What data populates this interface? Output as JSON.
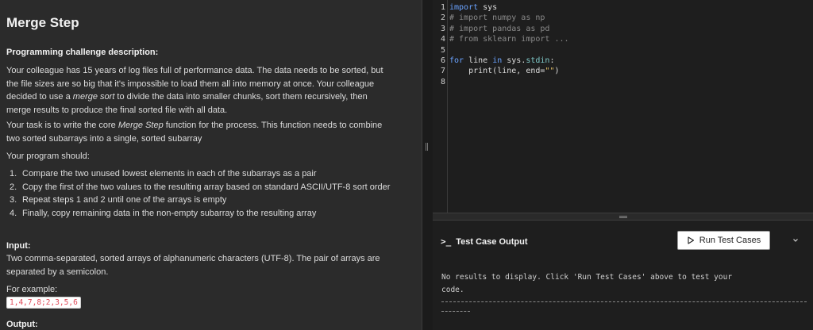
{
  "problem": {
    "title": "Merge Step",
    "section_heading": "Programming challenge description:",
    "para1": [
      "Your colleague has 15 years of log files full of performance data. The data needs to be sorted, but",
      "the file sizes are so big that it's impossible to load them all into memory at once. Your colleague",
      "decided to use a ",
      "merge sort",
      " to divide the data into smaller chunks, sort them recursively, then",
      "merge results to produce the final sorted file with all data."
    ],
    "para2": [
      "Your task is to write the core ",
      "Merge Step",
      " function for the process. This function needs to combine",
      "two sorted subarrays into a single, sorted subarray"
    ],
    "para3": "Your program should:",
    "steps": [
      {
        "num": "1.",
        "text": "Compare the two unused lowest elements in each of the subarrays as a pair"
      },
      {
        "num": "2.",
        "text": "Copy the first of the two values to the resulting array based on standard ASCII/UTF-8 sort order"
      },
      {
        "num": "3.",
        "text": "Repeat steps 1 and 2 until one of the arrays is empty"
      },
      {
        "num": "4.",
        "text": "Finally, copy remaining data in the non-empty subarray to the resulting array"
      }
    ],
    "input_heading": "Input:",
    "input_desc": [
      "Two comma-separated, sorted arrays of alphanumeric characters (UTF-8). The pair of arrays are",
      "separated by a semicolon."
    ],
    "example_label": "For example:",
    "example_value": "1,4,7,8;2,3,5,6",
    "output_heading": "Output:"
  },
  "editor": {
    "line_numbers": [
      "1",
      "2",
      "3",
      "4",
      "5",
      "6",
      "7",
      "8"
    ],
    "lines": [
      [
        {
          "t": "import",
          "c": "kw"
        },
        {
          "t": " sys",
          "c": ""
        }
      ],
      [
        {
          "t": "# import numpy as np",
          "c": "cm"
        }
      ],
      [
        {
          "t": "# import pandas as pd",
          "c": "cm"
        }
      ],
      [
        {
          "t": "# from sklearn import ...",
          "c": "cm"
        }
      ],
      [
        {
          "t": "",
          "c": ""
        }
      ],
      [
        {
          "t": "for",
          "c": "kw"
        },
        {
          "t": " line ",
          "c": ""
        },
        {
          "t": "in",
          "c": "kw"
        },
        {
          "t": " sys.",
          "c": ""
        },
        {
          "t": "stdin",
          "c": "attr"
        },
        {
          "t": ":",
          "c": ""
        }
      ],
      [
        {
          "t": "    print(line, end=",
          "c": ""
        },
        {
          "t": "\"\"",
          "c": "str"
        },
        {
          "t": ")",
          "c": ""
        }
      ],
      [
        {
          "t": "",
          "c": ""
        }
      ]
    ]
  },
  "output_panel": {
    "prompt_glyph": ">_",
    "title": "Test Case Output",
    "run_button_label": "Run Test Cases",
    "message_lines": [
      "No results to display. Click 'Run Test Cases' above to test your",
      "code."
    ]
  },
  "colors": {
    "panel_bg": "#2b2b2b",
    "editor_bg": "#1e1e1e",
    "keyword": "#6aa3ff",
    "comment": "#8a8a8a",
    "example_text": "#e04b5a"
  }
}
